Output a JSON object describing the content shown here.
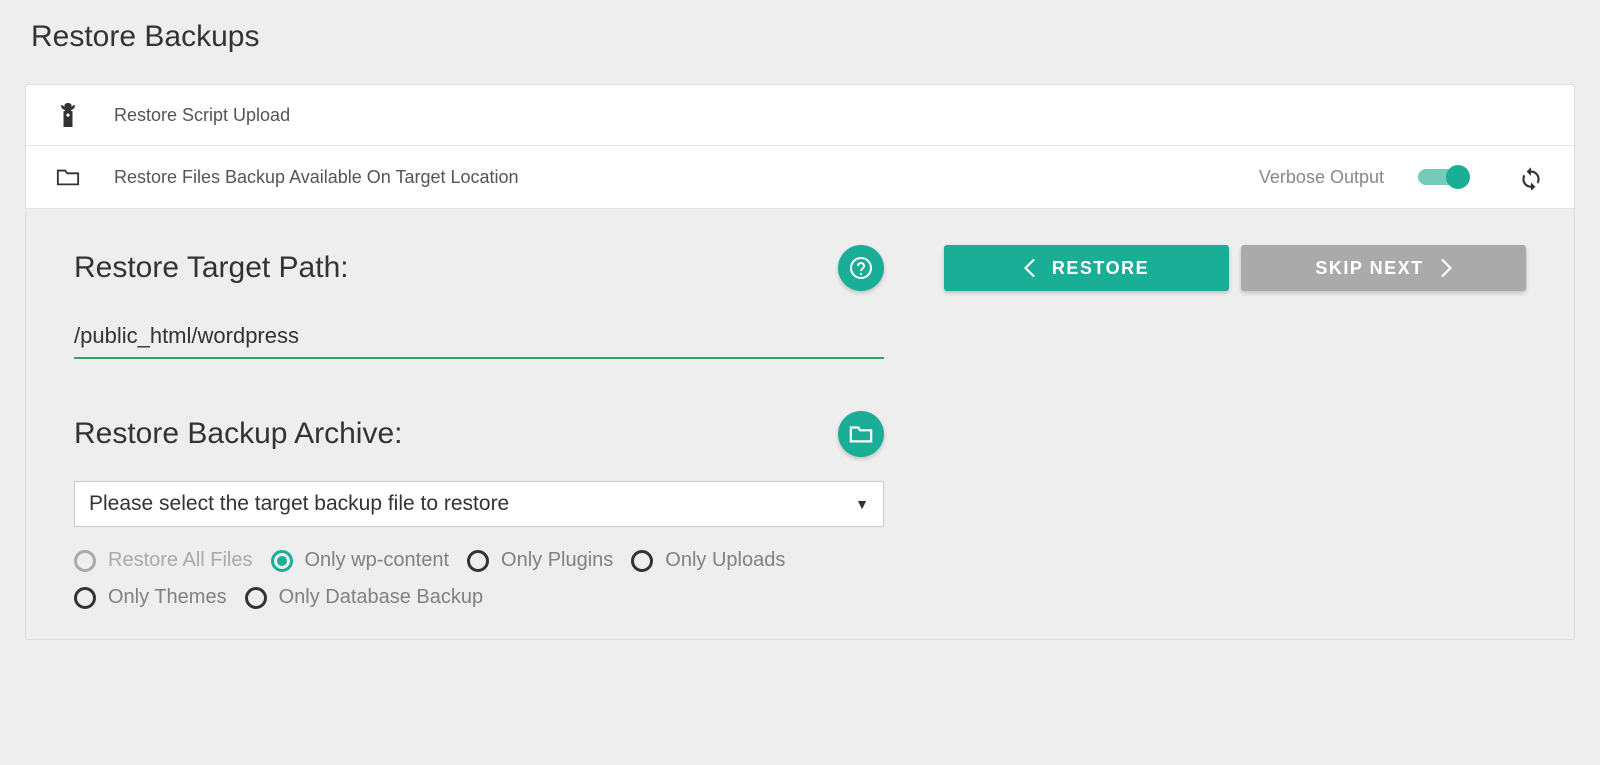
{
  "page": {
    "title": "Restore Backups"
  },
  "panels": {
    "upload": {
      "label": "Restore Script Upload"
    },
    "files": {
      "label": "Restore Files Backup Available On Target Location",
      "verbose_label": "Verbose Output",
      "verbose_on": true
    }
  },
  "target_path": {
    "label": "Restore Target Path:",
    "value": "/public_html/wordpress"
  },
  "archive": {
    "label": "Restore Backup Archive:",
    "placeholder": "Please select the target backup file to restore"
  },
  "radios": {
    "all": "Restore All Files",
    "wpcontent": "Only wp-content",
    "plugins": "Only Plugins",
    "uploads": "Only Uploads",
    "themes": "Only Themes",
    "database": "Only Database Backup",
    "selected": "wpcontent"
  },
  "buttons": {
    "restore": "Restore",
    "skip": "Skip Next"
  },
  "colors": {
    "accent": "#1aae96",
    "underline": "#30a662"
  }
}
